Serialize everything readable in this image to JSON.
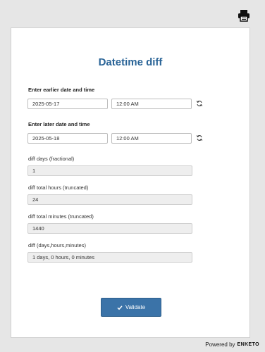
{
  "toolbar": {
    "print_icon": "print-icon"
  },
  "form": {
    "title": "Datetime diff",
    "earlier": {
      "label": "Enter earlier date and time",
      "date": "2025-05-17",
      "time": "12:00 AM"
    },
    "later": {
      "label": "Enter later date and time",
      "date": "2025-05-18",
      "time": "12:00 AM"
    },
    "diff_days": {
      "label": "diff days (fractional)",
      "value": "1"
    },
    "diff_hours": {
      "label": "diff total hours (truncated)",
      "value": "24"
    },
    "diff_minutes": {
      "label": "diff total minutes (truncated)",
      "value": "1440"
    },
    "diff_dhm": {
      "label": "diff (days,hours,minutes)",
      "value": "1 days, 0 hours, 0 minutes"
    },
    "validate_label": "Validate"
  },
  "footer": {
    "powered_by": "Powered by",
    "logo_text": "ENKETO"
  }
}
